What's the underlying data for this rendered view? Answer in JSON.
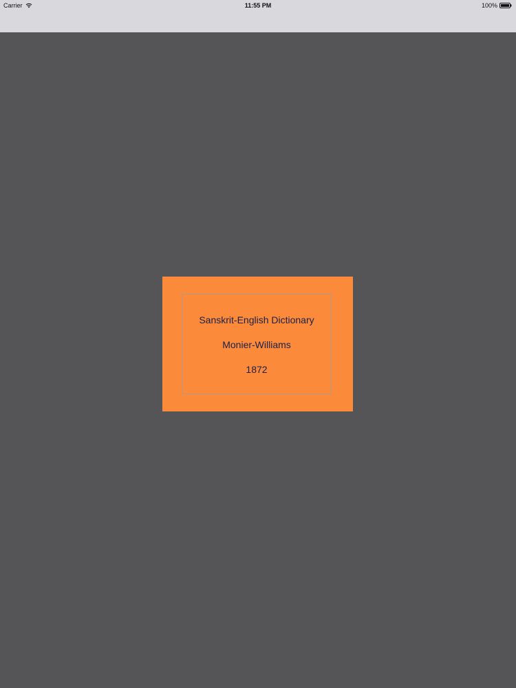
{
  "status_bar": {
    "carrier": "Carrier",
    "time": "11:55 PM",
    "battery": "100%"
  },
  "icons": {
    "wifi": "wifi-icon",
    "battery": "battery-icon"
  },
  "book": {
    "title": "Sanskrit-English Dictionary",
    "author": "Monier-Williams",
    "year": "1872"
  },
  "colors": {
    "background": "#555456",
    "status_bar": "#d9d8dc",
    "cover": "#fb8b3a",
    "cover_text": "#1a1f4a"
  }
}
